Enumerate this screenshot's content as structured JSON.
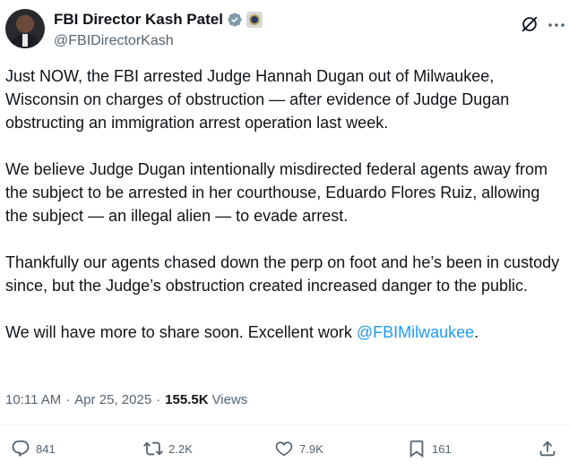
{
  "author": {
    "display_name": "FBI Director Kash Patel",
    "handle": "@FBIDirectorKash",
    "verified_icon": "verified-badge-icon",
    "affiliation_icon": "government-seal-icon"
  },
  "post": {
    "paragraphs": [
      "Just NOW, the FBI arrested Judge Hannah Dugan out of Milwaukee, Wisconsin on charges of obstruction — after evidence of Judge Dugan obstructing an immigration arrest operation last week.",
      "We believe Judge Dugan intentionally misdirected federal agents away from the subject to be arrested in her courthouse, Eduardo Flores Ruiz, allowing the subject — an illegal alien — to evade arrest.",
      "Thankfully our agents chased down the perp on foot and he’s been in custody since, but the Judge’s obstruction created increased danger to the public."
    ],
    "last_paragraph_prefix": "We will have more to share soon. Excellent work ",
    "mention": "@FBIMilwaukee",
    "last_paragraph_suffix": "."
  },
  "meta": {
    "time": "10:11 AM",
    "date": "Apr 25, 2025",
    "views_count": "155.5K",
    "views_label": "Views",
    "separator": "·"
  },
  "actions": {
    "replies": "841",
    "reposts": "2.2K",
    "likes": "7.9K",
    "bookmarks": "161"
  },
  "colors": {
    "text": "#0f1419",
    "secondary": "#536471",
    "accent": "#1d9bf0"
  }
}
